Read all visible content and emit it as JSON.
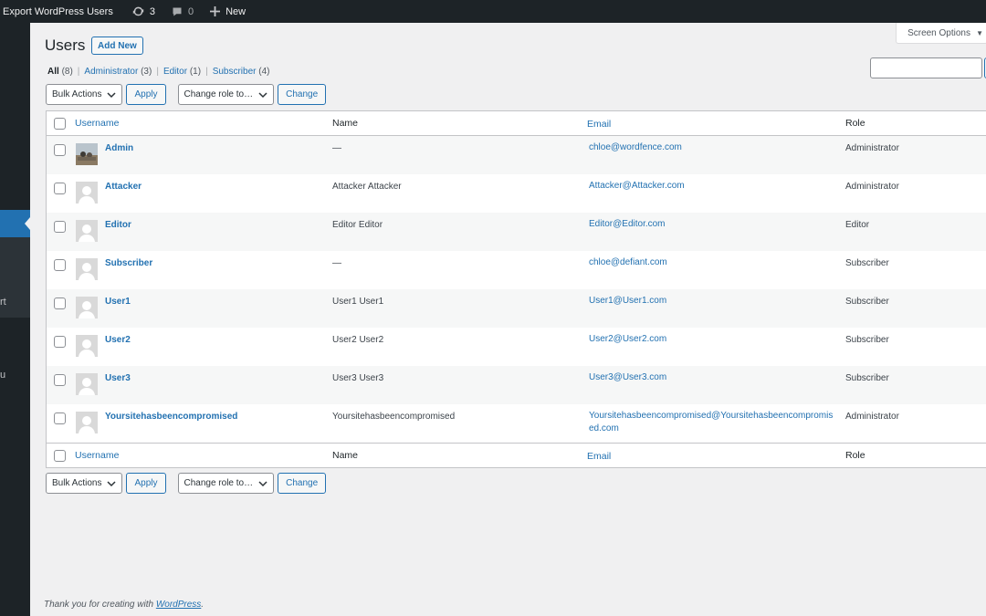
{
  "adminbar": {
    "site_title": "Export WordPress Users",
    "updates_count": "3",
    "comments_count": "0",
    "new_label": "New"
  },
  "sidebar": {
    "fragments": [
      "rt",
      "u"
    ]
  },
  "screen_options": "Screen Options",
  "page": {
    "title": "Users",
    "add_new": "Add New"
  },
  "filters": [
    {
      "label": "All",
      "count": "(8)",
      "current": true
    },
    {
      "label": "Administrator",
      "count": "(3)"
    },
    {
      "label": "Editor",
      "count": "(1)"
    },
    {
      "label": "Subscriber",
      "count": "(4)"
    }
  ],
  "tablenav": {
    "bulk_actions": "Bulk Actions",
    "apply": "Apply",
    "change_role": "Change role to…",
    "change": "Change"
  },
  "columns": {
    "username": "Username",
    "name": "Name",
    "email": "Email",
    "role": "Role"
  },
  "users": [
    {
      "username": "Admin",
      "name": "—",
      "email": "chloe@wordfence.com",
      "role": "Administrator",
      "photo": true
    },
    {
      "username": "Attacker",
      "name": "Attacker Attacker",
      "email": "Attacker@Attacker.com",
      "role": "Administrator"
    },
    {
      "username": "Editor",
      "name": "Editor Editor",
      "email": "Editor@Editor.com",
      "role": "Editor"
    },
    {
      "username": "Subscriber",
      "name": "—",
      "email": "chloe@defiant.com",
      "role": "Subscriber"
    },
    {
      "username": "User1",
      "name": "User1 User1",
      "email": "User1@User1.com",
      "role": "Subscriber"
    },
    {
      "username": "User2",
      "name": "User2 User2",
      "email": "User2@User2.com",
      "role": "Subscriber"
    },
    {
      "username": "User3",
      "name": "User3 User3",
      "email": "User3@User3.com",
      "role": "Subscriber"
    },
    {
      "username": "Yoursitehasbeencompromised",
      "name": "Yoursitehasbeencompromised",
      "email": "Yoursitehasbeencompromised@Yoursitehasbeencompromised.com",
      "role": "Administrator"
    }
  ],
  "footer": {
    "text": "Thank you for creating with ",
    "link": "WordPress",
    "end": "."
  }
}
